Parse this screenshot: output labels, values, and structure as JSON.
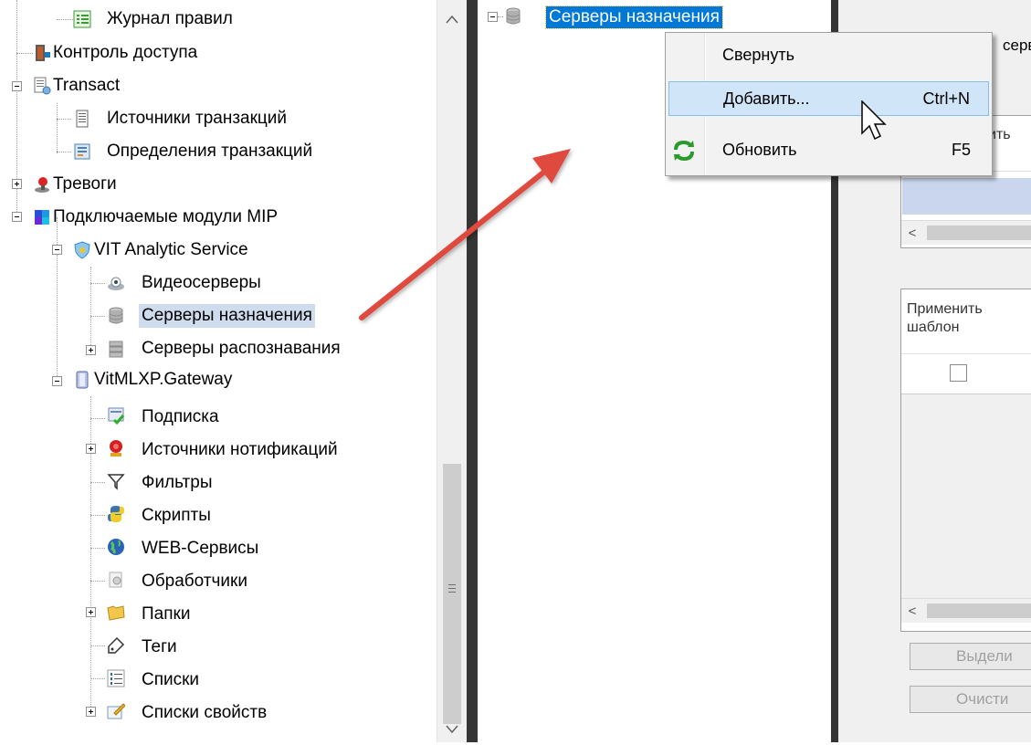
{
  "left_tree": {
    "items": [
      {
        "label": "Журнал правил",
        "icon": "list-icon"
      },
      {
        "label": "Контроль доступа",
        "icon": "access-control-icon"
      },
      {
        "label": "Transact",
        "icon": "transact-icon"
      },
      {
        "label": "Источники транзакций",
        "icon": "transaction-source-icon"
      },
      {
        "label": "Определения транзакций",
        "icon": "transaction-definition-icon"
      },
      {
        "label": "Тревоги",
        "icon": "alarm-icon"
      },
      {
        "label": "Подключаемые модули MIP",
        "icon": "puzzle-plugin-icon"
      },
      {
        "label": "VIT Analytic Service",
        "icon": "shield-service-icon"
      },
      {
        "label": "Видеосерверы",
        "icon": "video-server-icon"
      },
      {
        "label": "Серверы назначения",
        "icon": "database-icon"
      },
      {
        "label": "Серверы распознавания",
        "icon": "recognition-server-icon"
      },
      {
        "label": "VitMLXP.Gateway",
        "icon": "gateway-icon"
      },
      {
        "label": "Подписка",
        "icon": "subscription-icon"
      },
      {
        "label": "Источники нотификаций",
        "icon": "notification-source-icon"
      },
      {
        "label": "Фильтры",
        "icon": "filter-icon"
      },
      {
        "label": "Скрипты",
        "icon": "python-script-icon"
      },
      {
        "label": "WEB-Сервисы",
        "icon": "globe-icon"
      },
      {
        "label": "Обработчики",
        "icon": "handler-icon"
      },
      {
        "label": "Папки",
        "icon": "folder-icon"
      },
      {
        "label": "Теги",
        "icon": "tag-icon"
      },
      {
        "label": "Списки",
        "icon": "numbered-list-icon"
      },
      {
        "label": "Списки свойств",
        "icon": "property-list-icon"
      }
    ]
  },
  "middle_tree": {
    "root_label": "Серверы назначения"
  },
  "context_menu": {
    "items": [
      {
        "label": "Свернуть",
        "shortcut": ""
      },
      {
        "label": "Добавить...",
        "shortcut": "Ctrl+N"
      },
      {
        "label": "Обновить",
        "shortcut": "F5"
      }
    ]
  },
  "right_panel": {
    "header_partial": "серв",
    "col_header_partial": "ить",
    "apply_template_label": "Применить шаблон",
    "select_button": "Выдели",
    "clear_button": "Очисти"
  },
  "colors": {
    "selection": "#cfdced",
    "menu_hover": "#d0e6f8",
    "arrow": "#e0483d"
  }
}
